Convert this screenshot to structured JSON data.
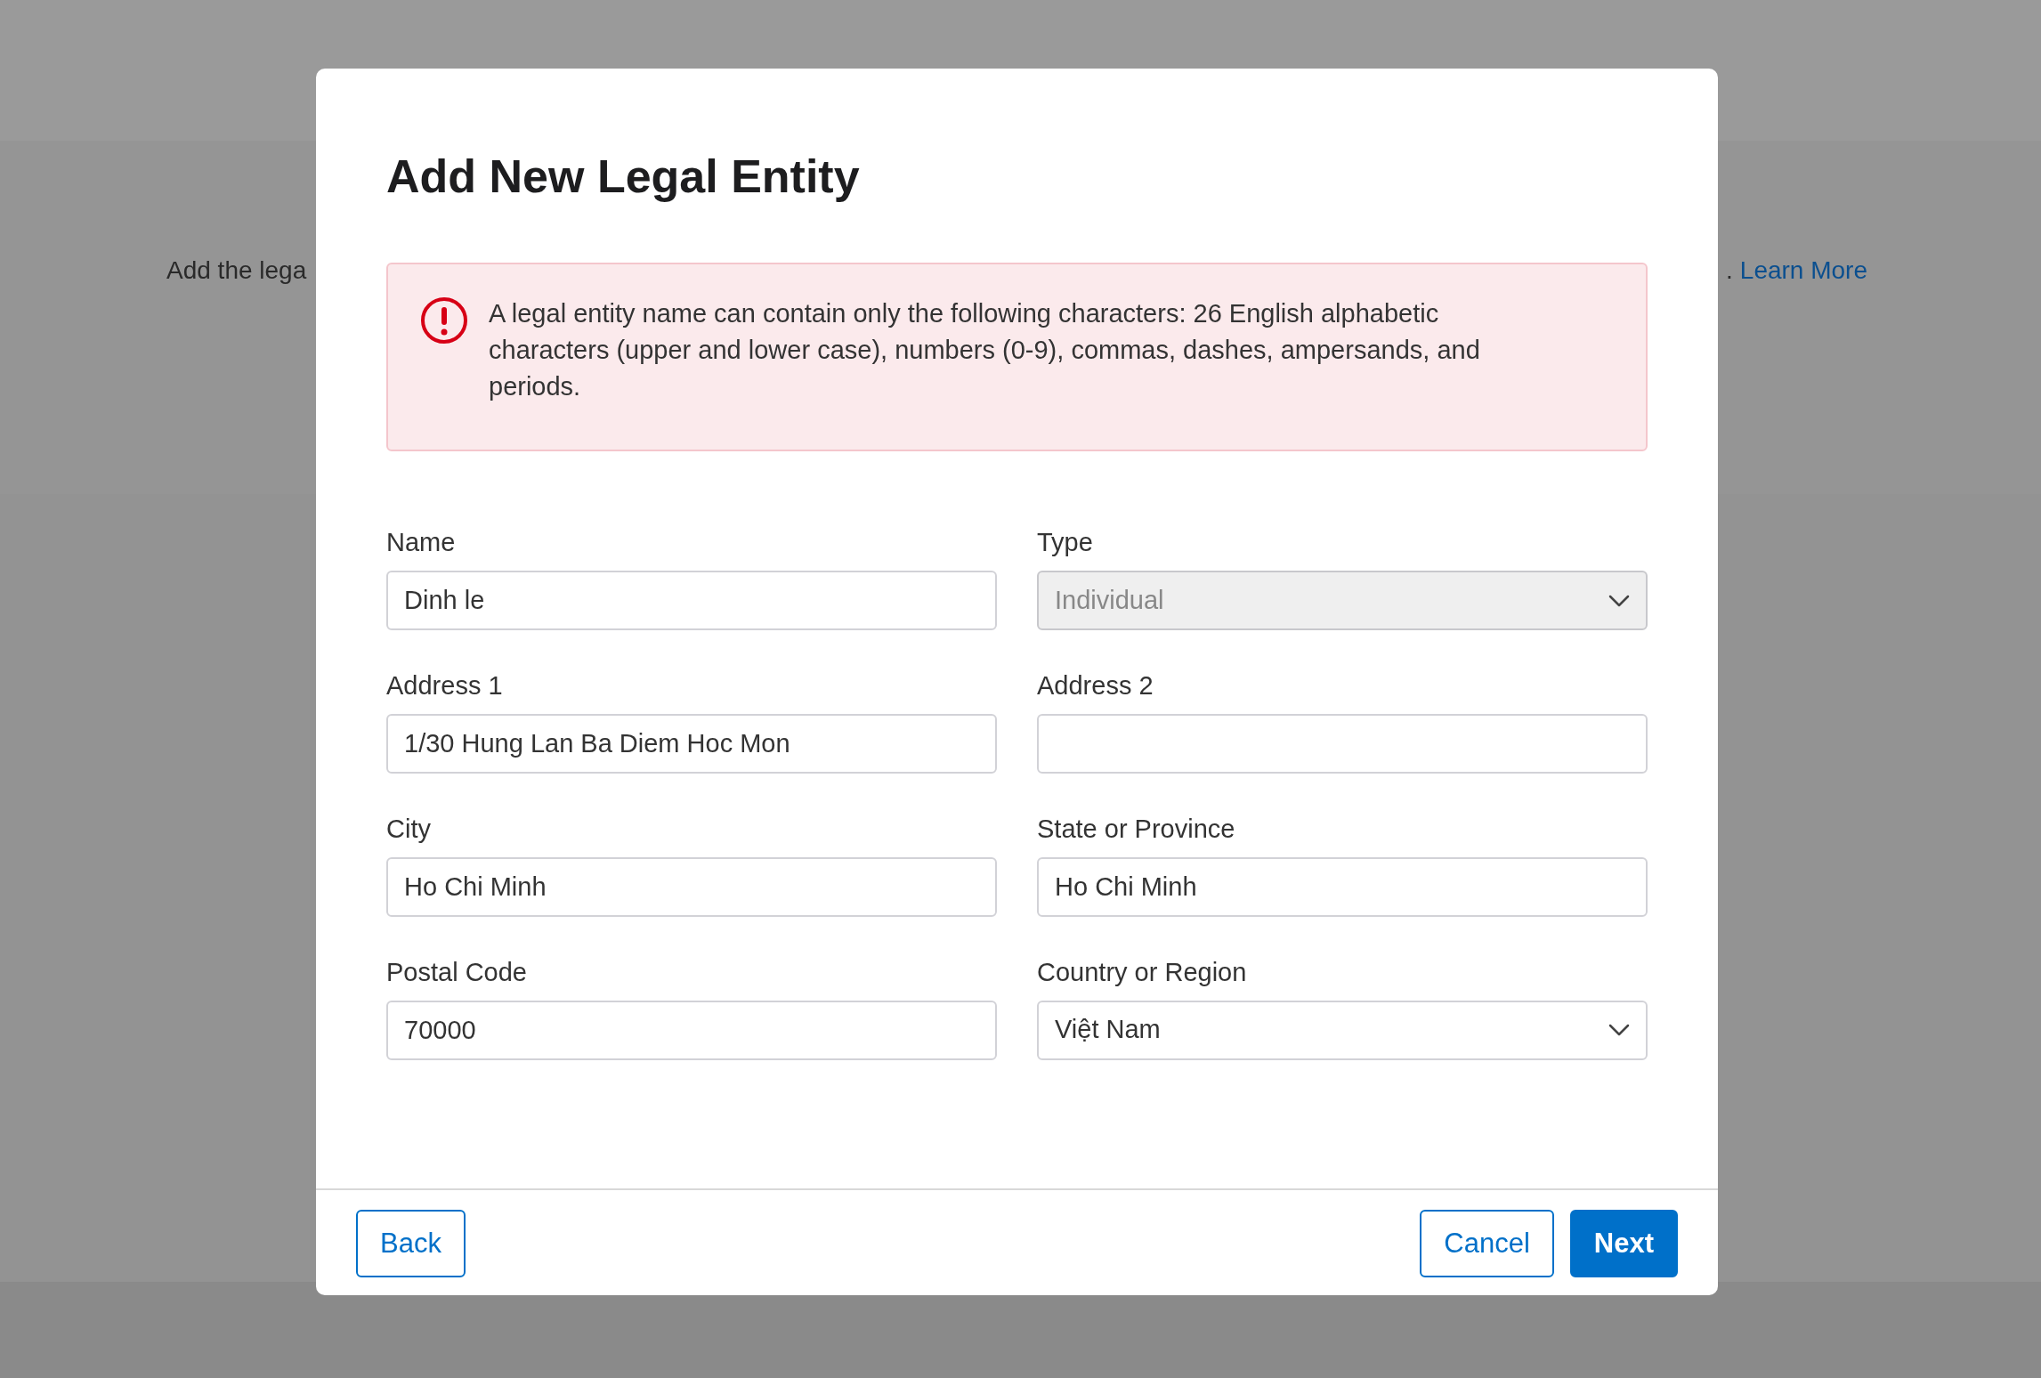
{
  "background": {
    "text_left": "Add the lega",
    "text_right": ".",
    "link": "Learn More"
  },
  "dialog": {
    "title": "Add New Legal Entity",
    "alert": {
      "message": "A legal entity name can contain only the following characters: 26 English alphabetic characters (upper and lower case), numbers (0-9), commas, dashes, ampersands, and periods."
    },
    "fields": [
      {
        "label": "Name",
        "kind": "text",
        "value": "Dinh le",
        "disabled": false
      },
      {
        "label": "Type",
        "kind": "select",
        "value": "Individual",
        "disabled": true
      },
      {
        "label": "Address 1",
        "kind": "text",
        "value": "1/30 Hung Lan Ba Diem Hoc Mon",
        "disabled": false
      },
      {
        "label": "Address 2",
        "kind": "text",
        "disabled": false
      },
      {
        "label": "City",
        "kind": "text",
        "value": "Ho Chi Minh",
        "disabled": false
      },
      {
        "label": "State or Province",
        "kind": "text",
        "value": "Ho Chi Minh",
        "disabled": false
      },
      {
        "label": "Postal Code",
        "kind": "text",
        "value": "70000",
        "disabled": false
      },
      {
        "label": "Country or Region",
        "kind": "select",
        "value": "Việt Nam",
        "disabled": false
      }
    ],
    "buttons": [
      {
        "label": "Back",
        "kind": "secondary"
      },
      {
        "label": "Cancel",
        "kind": "secondary"
      },
      {
        "label": "Next",
        "kind": "primary"
      }
    ]
  }
}
